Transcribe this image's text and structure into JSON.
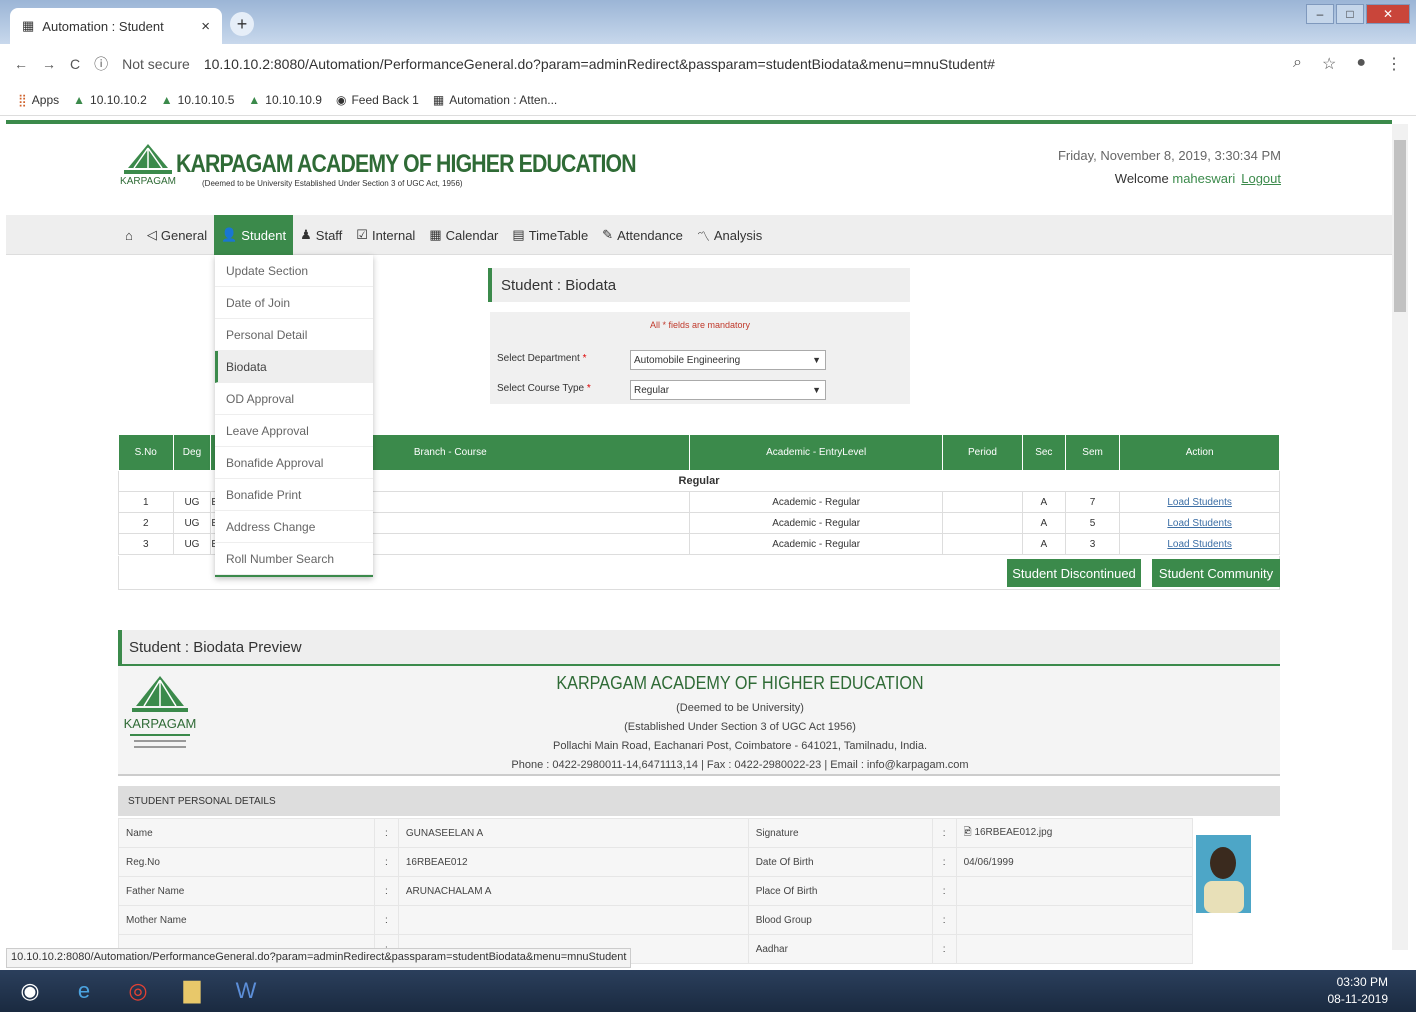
{
  "browser": {
    "tab_title": "Automation : Student",
    "url_prefix": "Not secure",
    "url": "10.10.10.2:8080/Automation/PerformanceGeneral.do?param=adminRedirect&passparam=studentBiodata&menu=mnuStudent#",
    "bookmarks": [
      "Apps",
      "10.10.10.2",
      "10.10.10.5",
      "10.10.10.9",
      "Feed Back 1",
      "Automation : Atten..."
    ]
  },
  "header": {
    "org_name": "KARPAGAM ACADEMY OF HIGHER EDUCATION",
    "org_sub": "(Deemed to be University Established Under Section 3 of UGC Act, 1956)",
    "logo_text": "KARPAGAM",
    "datetime": "Friday, November 8, 2019, 3:30:34 PM",
    "welcome": "Welcome",
    "username": "maheswari",
    "logout": "Logout"
  },
  "nav": {
    "items": [
      "General",
      "Student",
      "Staff",
      "Internal",
      "Calendar",
      "TimeTable",
      "Attendance",
      "Analysis"
    ]
  },
  "student_menu": [
    "Update Section",
    "Date of Join",
    "Personal Detail",
    "Biodata",
    "OD Approval",
    "Leave Approval",
    "Bonafide Approval",
    "Bonafide Print",
    "Address Change",
    "Roll Number Search"
  ],
  "biodata": {
    "title": "Student : Biodata",
    "mandatory_note": "All * fields are mandatory",
    "dept_label": "Select Department",
    "dept_value": "Automobile Engineering",
    "course_label": "Select Course Type",
    "course_value": "Regular",
    "required_mark": "*"
  },
  "table": {
    "headers": [
      "S.No",
      "Deg",
      "Branch - Course",
      "Academic - EntryLevel",
      "Period",
      "Sec",
      "Sem",
      "Action"
    ],
    "group": "Regular",
    "rows": [
      {
        "sno": "1",
        "deg": "UG",
        "branch": "Engineering",
        "academic": "Academic - Regular",
        "period": "",
        "sec": "A",
        "sem": "7",
        "action": "Load Students"
      },
      {
        "sno": "2",
        "deg": "UG",
        "branch": "Engineering",
        "academic": "Academic - Regular",
        "period": "",
        "sec": "A",
        "sem": "5",
        "action": "Load Students"
      },
      {
        "sno": "3",
        "deg": "UG",
        "branch": "Engineering",
        "academic": "Academic - Regular",
        "period": "",
        "sec": "A",
        "sem": "3",
        "action": "Load Students"
      }
    ],
    "btn_discontinued": "Student Discontinued",
    "btn_community": "Student Community"
  },
  "preview": {
    "title": "Student : Biodata Preview",
    "org_name": "KARPAGAM ACADEMY OF HIGHER EDUCATION",
    "line1": "(Deemed to be University)",
    "line2": "(Established Under Section 3 of UGC Act 1956)",
    "line3": "Pollachi Main Road, Eachanari Post, Coimbatore - 641021, Tamilnadu, India.",
    "line4": "Phone : 0422-2980011-14,6471113,14 | Fax : 0422-2980022-23 | Email : info@karpagam.com",
    "logo_text": "KARPAGAM",
    "section": "STUDENT PERSONAL DETAILS",
    "rows": [
      {
        "l1": "Name",
        "v1": "GUNASEELAN A",
        "l2": "Signature",
        "v2": "16RBEAE012.jpg"
      },
      {
        "l1": "Reg.No",
        "v1": "16RBEAE012",
        "l2": "Date Of Birth",
        "v2": "04/06/1999"
      },
      {
        "l1": "Father Name",
        "v1": "ARUNACHALAM A",
        "l2": "Place Of Birth",
        "v2": ""
      },
      {
        "l1": "Mother Name",
        "v1": "",
        "l2": "Blood Group",
        "v2": ""
      },
      {
        "l1": "",
        "v1": "",
        "l2": "Aadhar",
        "v2": ""
      }
    ]
  },
  "status_url": "10.10.10.2:8080/Automation/PerformanceGeneral.do?param=adminRedirect&passparam=studentBiodata&menu=mnuStudent",
  "taskbar": {
    "time": "03:30 PM",
    "date": "08-11-2019"
  },
  "colors": {
    "primary": "#3b8a4b",
    "link": "#3b6ea5"
  }
}
